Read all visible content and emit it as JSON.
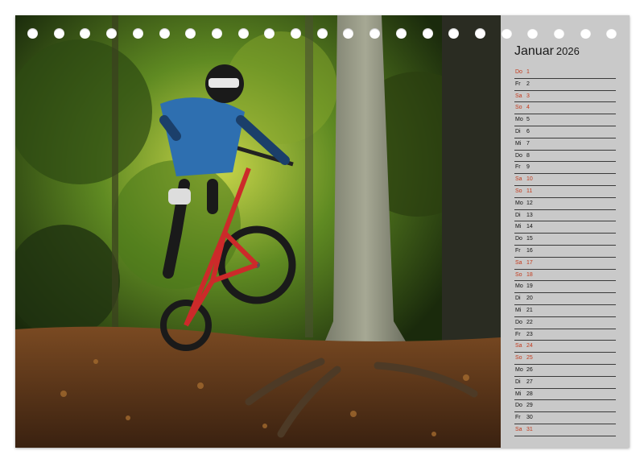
{
  "calendar": {
    "month": "Januar",
    "year": "2026",
    "days": [
      {
        "wd": "Do",
        "dn": "1",
        "weekend": true
      },
      {
        "wd": "Fr",
        "dn": "2",
        "weekend": false
      },
      {
        "wd": "Sa",
        "dn": "3",
        "weekend": true
      },
      {
        "wd": "So",
        "dn": "4",
        "weekend": true
      },
      {
        "wd": "Mo",
        "dn": "5",
        "weekend": false
      },
      {
        "wd": "Di",
        "dn": "6",
        "weekend": false
      },
      {
        "wd": "Mi",
        "dn": "7",
        "weekend": false
      },
      {
        "wd": "Do",
        "dn": "8",
        "weekend": false
      },
      {
        "wd": "Fr",
        "dn": "9",
        "weekend": false
      },
      {
        "wd": "Sa",
        "dn": "10",
        "weekend": true
      },
      {
        "wd": "So",
        "dn": "11",
        "weekend": true
      },
      {
        "wd": "Mo",
        "dn": "12",
        "weekend": false
      },
      {
        "wd": "Di",
        "dn": "13",
        "weekend": false
      },
      {
        "wd": "Mi",
        "dn": "14",
        "weekend": false
      },
      {
        "wd": "Do",
        "dn": "15",
        "weekend": false
      },
      {
        "wd": "Fr",
        "dn": "16",
        "weekend": false
      },
      {
        "wd": "Sa",
        "dn": "17",
        "weekend": true
      },
      {
        "wd": "So",
        "dn": "18",
        "weekend": true
      },
      {
        "wd": "Mo",
        "dn": "19",
        "weekend": false
      },
      {
        "wd": "Di",
        "dn": "20",
        "weekend": false
      },
      {
        "wd": "Mi",
        "dn": "21",
        "weekend": false
      },
      {
        "wd": "Do",
        "dn": "22",
        "weekend": false
      },
      {
        "wd": "Fr",
        "dn": "23",
        "weekend": false
      },
      {
        "wd": "Sa",
        "dn": "24",
        "weekend": true
      },
      {
        "wd": "So",
        "dn": "25",
        "weekend": true
      },
      {
        "wd": "Mo",
        "dn": "26",
        "weekend": false
      },
      {
        "wd": "Di",
        "dn": "27",
        "weekend": false
      },
      {
        "wd": "Mi",
        "dn": "28",
        "weekend": false
      },
      {
        "wd": "Do",
        "dn": "29",
        "weekend": false
      },
      {
        "wd": "Fr",
        "dn": "30",
        "weekend": false
      },
      {
        "wd": "Sa",
        "dn": "31",
        "weekend": true
      }
    ]
  },
  "photo": {
    "subject": "mountain-biker-jumping-in-forest",
    "colors": {
      "foliage": "#3f6a1c",
      "trunk": "#8a8d7a",
      "ground": "#5a3418",
      "jersey": "#2e6fb0"
    }
  },
  "colors": {
    "panel": "#c9c9c9",
    "weekend_text": "#c43a1c",
    "weekday_text": "#111111",
    "rule": "#3a3a3a"
  }
}
